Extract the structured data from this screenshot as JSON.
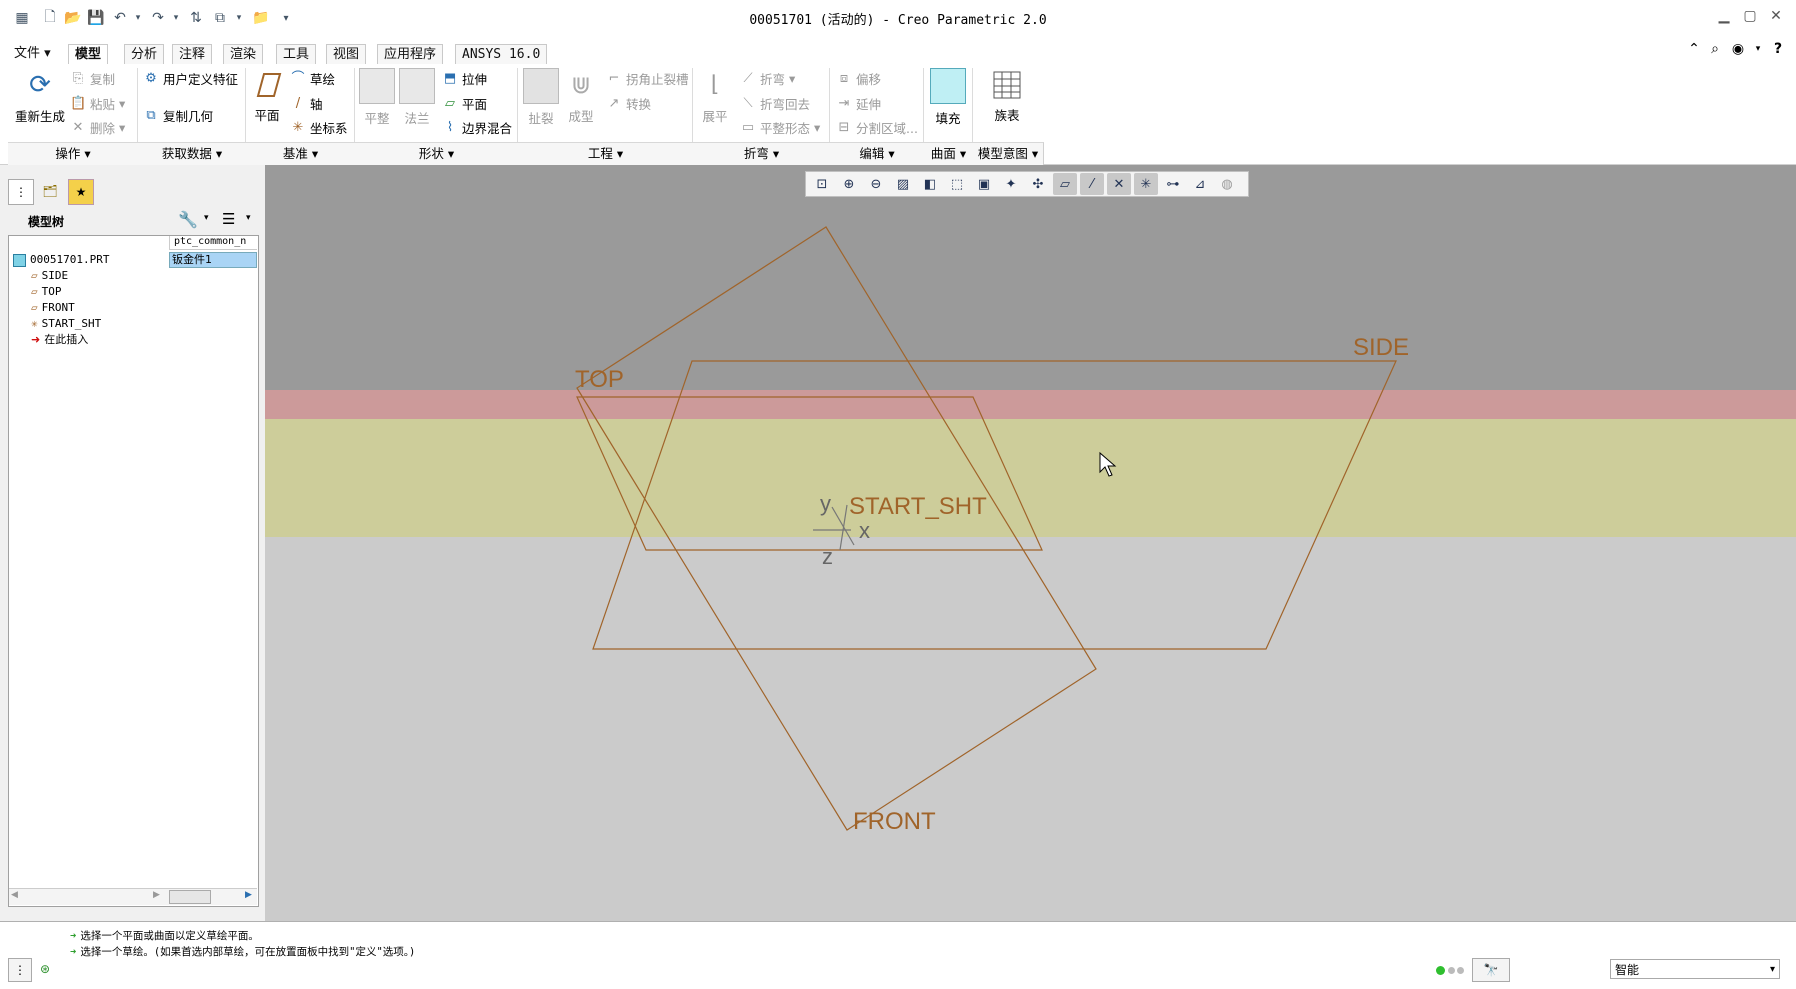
{
  "window": {
    "title": "00051701 (活动的) - Creo Parametric 2.0"
  },
  "tabs": [
    "文件",
    "模型",
    "分析",
    "注释",
    "渲染",
    "工具",
    "视图",
    "应用程序",
    "ANSYS 16.0"
  ],
  "active_tab": "模型",
  "ribbon": {
    "regenerate": "重新生成",
    "copy": "复制",
    "paste": "粘贴",
    "delete": "删除",
    "user_feature": "用户定义特征",
    "copy_geometry": "复制几何",
    "plane_big": "平面",
    "sketch": "草绘",
    "axis": "轴",
    "csys": "坐标系",
    "flat": "平整",
    "flange": "法兰",
    "extrude": "拉伸",
    "plane": "平面",
    "boundary_blend": "边界混合",
    "rip": "扯裂",
    "form": "成型",
    "corner_relief": "拐角止裂槽",
    "convert": "转换",
    "unbend": "展平",
    "bend": "折弯",
    "bend_back": "折弯回去",
    "flat_pattern": "平整形态",
    "offset": "偏移",
    "extend": "延伸",
    "split_area": "分割区域...",
    "fill": "填充",
    "family_table": "族表",
    "groups": [
      "操作",
      "获取数据",
      "基准",
      "形状",
      "工程",
      "折弯",
      "编辑",
      "曲面",
      "模型意图"
    ]
  },
  "model_tree": {
    "header": "模型树",
    "column": "ptc_common_n",
    "root": "00051701.PRT",
    "root_value": "钣金件1",
    "items": [
      "SIDE",
      "TOP",
      "FRONT",
      "START_SHT",
      "在此插入"
    ]
  },
  "viewport": {
    "labels": {
      "top": "TOP",
      "side": "SIDE",
      "front": "FRONT",
      "csys": "START_SHT",
      "x": "x",
      "y": "y",
      "z": "z"
    },
    "datum_color": "#a0642a",
    "band_colors": [
      "#9a9a9a",
      "#cc9a9a",
      "#cdcd9a",
      "#cbcbcb"
    ]
  },
  "messages": [
    "选择一个平面或曲面以定义草绘平面。",
    "选择一个草绘。(如果首选内部草绘，可在放置面板中找到\"定义\"选项。)"
  ],
  "status": {
    "filter": "智能"
  }
}
